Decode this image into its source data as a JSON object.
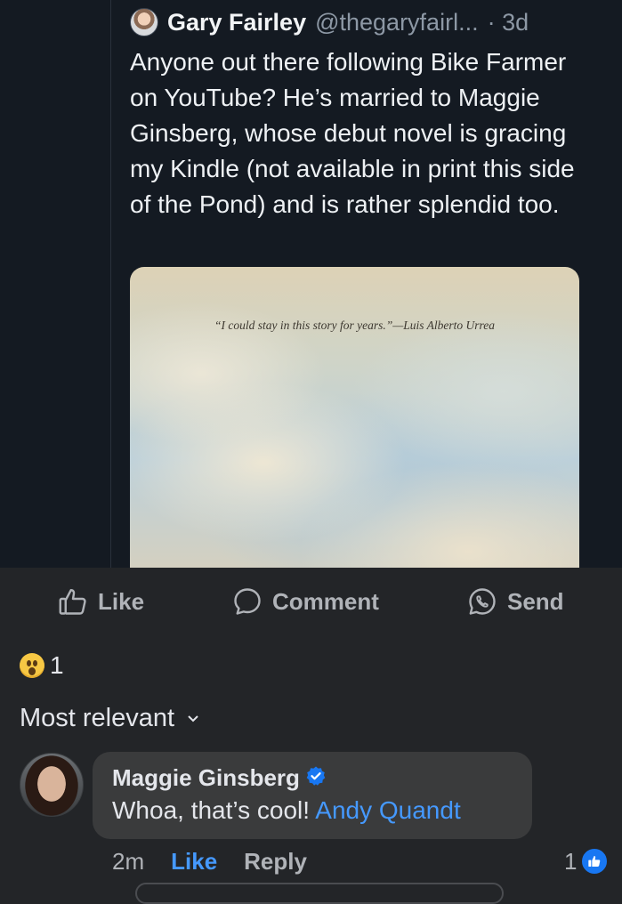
{
  "tweet": {
    "author_name": "Gary Fairley",
    "handle": "@thegaryfairl...",
    "age": "· 3d",
    "text": "Anyone out there following Bike Farmer on YouTube? He’s married to Maggie Ginsberg, whose debut novel is gracing my Kindle (not available in print this side of the Pond) and is rather splendid too.",
    "media_quote": "“I could stay in this story for years.”—Luis Alberto Urrea"
  },
  "actions": {
    "like_label": "Like",
    "comment_label": "Comment",
    "send_label": "Send"
  },
  "reactions": {
    "emoji": "wow-emoji",
    "count": "1"
  },
  "sort": {
    "label": "Most relevant"
  },
  "comment": {
    "author": "Maggie Ginsberg",
    "text": "Whoa, that’s cool! ",
    "mention": "Andy Quandt",
    "time": "2m",
    "like_label": "Like",
    "reply_label": "Reply",
    "reaction_count": "1"
  },
  "colors": {
    "background": "#232528",
    "bubble": "#3a3b3c",
    "link_blue": "#4599ff",
    "like_blue": "#1877f2",
    "muted_text": "#b0b3b8"
  }
}
